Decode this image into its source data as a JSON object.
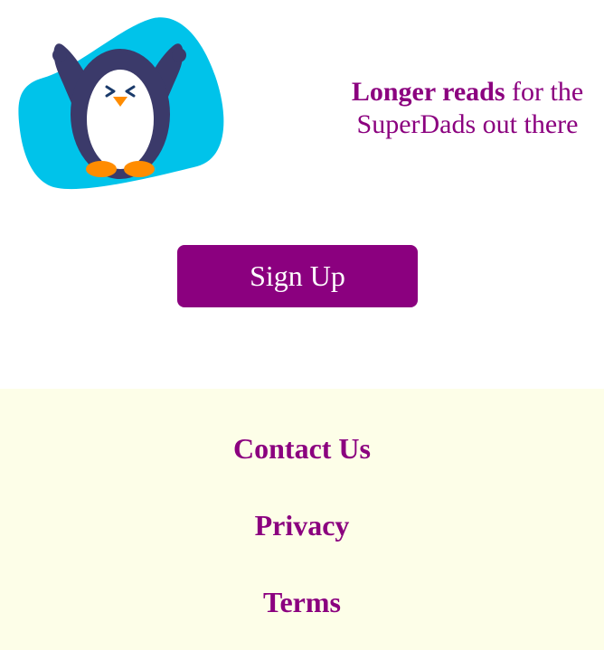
{
  "hero": {
    "mascot": "penguin-mascot",
    "tagline_bold": "Longer reads",
    "tagline_rest_line1": " for the",
    "tagline_line2": "SuperDads out there",
    "signup_label": "Sign Up"
  },
  "footer": {
    "links": [
      {
        "label": "Contact Us"
      },
      {
        "label": "Privacy"
      },
      {
        "label": "Terms"
      }
    ]
  },
  "colors": {
    "accent": "#8b007f",
    "mascot_bg": "#00c3ea",
    "footer_bg": "#fdfee8",
    "penguin_body": "#3b3a6a",
    "penguin_feet": "#ff8c00"
  }
}
